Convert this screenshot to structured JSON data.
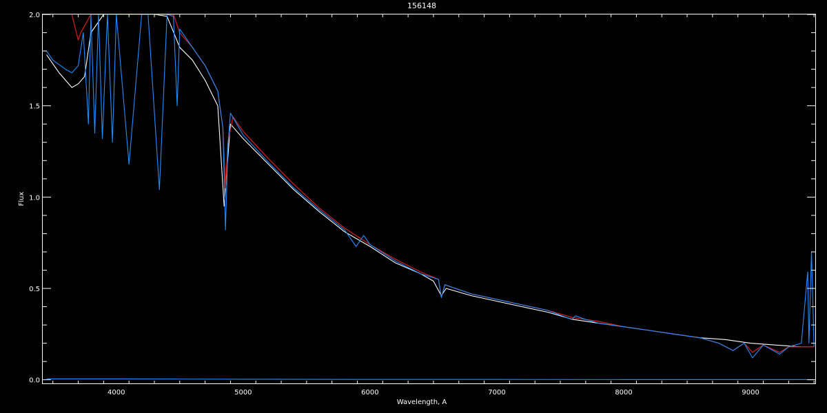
{
  "chart_data": {
    "type": "line",
    "title": "156148",
    "xlabel": "Wavelength, A",
    "ylabel": "Flux",
    "xlim": [
      3420,
      9510
    ],
    "ylim": [
      -0.02,
      2.0
    ],
    "x_ticks": [
      4000,
      5000,
      6000,
      7000,
      8000,
      9000
    ],
    "x_tick_labels": [
      "4000",
      "5000",
      "6000",
      "7000",
      "8000",
      "9000"
    ],
    "y_ticks": [
      0.0,
      0.5,
      1.0,
      1.5,
      2.0
    ],
    "y_tick_labels": [
      "0.0",
      "0.5",
      "1.0",
      "1.5",
      "2.0"
    ],
    "background": "#000000",
    "axis_color": "#ffffff",
    "grid": false,
    "series": [
      {
        "color": "#ffffff",
        "style": "observed spectrum",
        "x": [
          3450,
          3550,
          3650,
          3700,
          3750,
          3800,
          3900,
          4000,
          4100,
          4200,
          4300,
          4400,
          4500,
          4600,
          4700,
          4800,
          4850,
          4900,
          4950,
          5000,
          5200,
          5400,
          5600,
          5800,
          6000,
          6200,
          6400,
          6500,
          6562,
          6600,
          6800,
          7000,
          7200,
          7400,
          7600,
          7800,
          8000,
          8200,
          8400,
          8600,
          8800,
          9000,
          9200,
          9400,
          9500
        ],
        "y": [
          1.78,
          1.68,
          1.6,
          1.62,
          1.66,
          1.9,
          2.0,
          2.0,
          2.0,
          2.0,
          2.0,
          1.99,
          1.82,
          1.75,
          1.64,
          1.5,
          0.95,
          1.4,
          1.36,
          1.32,
          1.18,
          1.04,
          0.92,
          0.81,
          0.73,
          0.64,
          0.58,
          0.54,
          0.46,
          0.5,
          0.46,
          0.43,
          0.4,
          0.37,
          0.33,
          0.31,
          0.29,
          0.27,
          0.25,
          0.23,
          0.22,
          0.2,
          0.19,
          0.18,
          0.18
        ]
      },
      {
        "color": "#cc1f1f",
        "style": "model spectrum",
        "x": [
          3650,
          3700,
          3720,
          3800,
          3900,
          4000,
          4100,
          4200,
          4300,
          4400,
          4450,
          4500,
          4600,
          4700,
          4800,
          4840,
          4861,
          4880,
          4920,
          5000,
          5200,
          5400,
          5600,
          5800,
          6000,
          6200,
          6400,
          6540,
          6562,
          6590,
          6800,
          7000,
          7200,
          7400,
          7600,
          7800,
          8000,
          8200,
          8400,
          8600,
          8750,
          8862,
          8950,
          9015,
          9100,
          9230,
          9300,
          9500
        ],
        "y": [
          2.0,
          1.86,
          1.9,
          2.0,
          2.0,
          2.0,
          2.0,
          2.0,
          2.0,
          2.0,
          2.0,
          1.9,
          1.82,
          1.72,
          1.58,
          1.38,
          1.05,
          1.3,
          1.44,
          1.36,
          1.21,
          1.07,
          0.94,
          0.83,
          0.74,
          0.66,
          0.59,
          0.55,
          0.45,
          0.52,
          0.47,
          0.44,
          0.41,
          0.38,
          0.34,
          0.32,
          0.29,
          0.27,
          0.25,
          0.23,
          0.2,
          0.16,
          0.2,
          0.15,
          0.19,
          0.15,
          0.18,
          0.18
        ]
      },
      {
        "color": "#1f8fff",
        "style": "calibrated spectrum",
        "x": [
          3450,
          3500,
          3600,
          3650,
          3700,
          3740,
          3780,
          3800,
          3830,
          3860,
          3890,
          3930,
          3970,
          4000,
          4100,
          4200,
          4250,
          4340,
          4400,
          4450,
          4480,
          4500,
          4600,
          4700,
          4800,
          4840,
          4861,
          4880,
          4900,
          4950,
          5000,
          5200,
          5400,
          5600,
          5800,
          5890,
          5950,
          6000,
          6200,
          6400,
          6540,
          6562,
          6590,
          6800,
          7000,
          7200,
          7400,
          7590,
          7620,
          7700,
          7800,
          8000,
          8200,
          8400,
          8600,
          8750,
          8862,
          8950,
          9015,
          9100,
          9230,
          9300,
          9400,
          9450,
          9460,
          9480,
          9500
        ],
        "y": [
          1.8,
          1.75,
          1.7,
          1.68,
          1.72,
          1.9,
          1.4,
          2.0,
          1.35,
          2.0,
          1.32,
          2.0,
          1.3,
          2.0,
          1.18,
          2.0,
          2.0,
          1.04,
          2.0,
          1.99,
          1.5,
          1.92,
          1.82,
          1.72,
          1.58,
          1.38,
          0.82,
          1.28,
          1.46,
          1.4,
          1.34,
          1.19,
          1.05,
          0.93,
          0.82,
          0.73,
          0.79,
          0.74,
          0.65,
          0.58,
          0.55,
          0.45,
          0.52,
          0.47,
          0.44,
          0.41,
          0.38,
          0.33,
          0.35,
          0.33,
          0.31,
          0.29,
          0.27,
          0.25,
          0.23,
          0.2,
          0.16,
          0.2,
          0.12,
          0.19,
          0.14,
          0.18,
          0.2,
          0.59,
          0.2,
          0.7,
          0.18
        ]
      },
      {
        "color": "#1f8fff",
        "style": "baseline",
        "x": [
          3450,
          4000,
          5000,
          6000,
          7000,
          8000,
          9000,
          9500
        ],
        "y": [
          0.005,
          0.005,
          0.003,
          0.002,
          0.002,
          0.001,
          0.001,
          0.001
        ]
      }
    ]
  }
}
